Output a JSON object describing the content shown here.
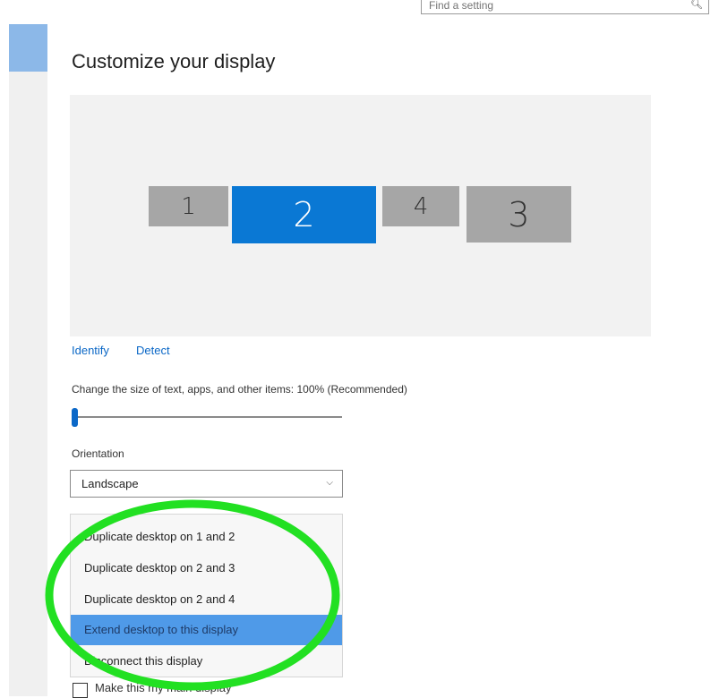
{
  "window": {
    "title": "Customize your display"
  },
  "search": {
    "placeholder": "Find a setting"
  },
  "displays": [
    {
      "id": "1",
      "label": "1",
      "selected": false
    },
    {
      "id": "2",
      "label": "2",
      "selected": true
    },
    {
      "id": "4",
      "label": "4",
      "selected": false
    },
    {
      "id": "3",
      "label": "3",
      "selected": false
    }
  ],
  "actions": {
    "identify": "Identify",
    "detect": "Detect"
  },
  "scale": {
    "label": "Change the size of text, apps, and other items: 100% (Recommended)",
    "value_percent": 100,
    "slider_fraction": 0.0
  },
  "orientation": {
    "label": "Orientation",
    "value": "Landscape"
  },
  "multiple_displays": {
    "options": [
      "Duplicate desktop on 1 and 2",
      "Duplicate desktop on 2 and 3",
      "Duplicate desktop on 2 and 4",
      "Extend desktop to this display",
      "Disconnect this display"
    ],
    "selected_index": 3
  },
  "main_display": {
    "label": "Make this my main display",
    "checked": false
  },
  "colors": {
    "accent": "#0a78d4",
    "selected_option": "#4f9ae8",
    "inactive_monitor": "#a6a6a6",
    "annotation": "#22e022"
  },
  "icons": {
    "search": "search-icon",
    "dropdown": "chevron-down-icon"
  }
}
